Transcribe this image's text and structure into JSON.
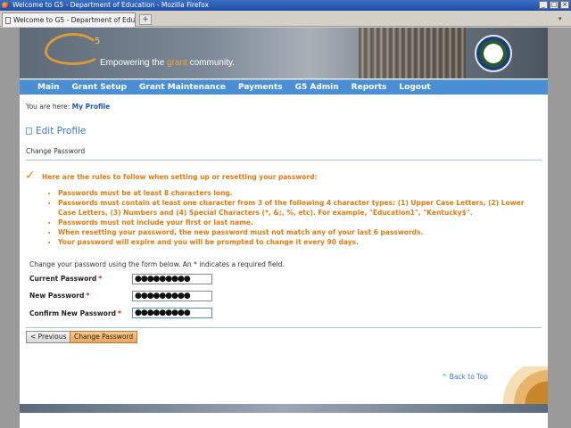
{
  "window": {
    "title": "Welcome to G5 - Department of Education - Mozilla Firefox",
    "controls": [
      "_",
      "□",
      "×"
    ]
  },
  "tabs": {
    "active_label": "Welcome to G5 - Department of Edu...",
    "new_tab": "+",
    "list_icon": "▾"
  },
  "banner": {
    "logo_text": "G",
    "logo_sup": "5",
    "tagline_pre": "Empowering the ",
    "tagline_highlight": "grant",
    "tagline_post": " community."
  },
  "nav": {
    "items": [
      "Main",
      "Grant Setup",
      "Grant Maintenance",
      "Payments",
      "G5 Admin",
      "Reports",
      "Logout"
    ]
  },
  "breadcrumb": {
    "prefix": "You are here:",
    "current": "My Profile"
  },
  "page": {
    "title": "Edit Profile",
    "subtitle": "Change Password"
  },
  "rules": {
    "intro": "Here are the rules to follow when setting up or resetting your password:",
    "items": [
      "Passwords must be at least 8 characters long.",
      "Passwords must contain at least one character from 3 of the following 4 character types: (1) Upper Case Letters, (2) Lower Case Letters, (3) Numbers and (4) Special Characters (*, &;, %, etc). For example, \"Education1\", \"Kentucky$\".",
      "Passwords must not include your first or last name.",
      "When resetting your password, the new password must not match any of your last 6 passwords.",
      "Your password will expire and you will be prompted to change it every 90 days."
    ]
  },
  "form": {
    "intro": "Change your password using the form below. An * indicates a required field.",
    "required_mark": "*",
    "fields": [
      {
        "label": "Current Password",
        "value": "●●●●●●●●●"
      },
      {
        "label": "New Password",
        "value": "●●●●●●●●●"
      },
      {
        "label": "Confirm New Password",
        "value": "●●●●●●●●●"
      }
    ]
  },
  "buttons": {
    "previous": "< Previous",
    "change_password": "Change Password"
  },
  "footer": {
    "back_to_top": "^ Back to Top"
  },
  "colors": {
    "nav_bar": "#4a8fd4",
    "rules_text": "#e07b10",
    "title_blue": "#3a77b8",
    "primary_button": "#eea65a"
  }
}
